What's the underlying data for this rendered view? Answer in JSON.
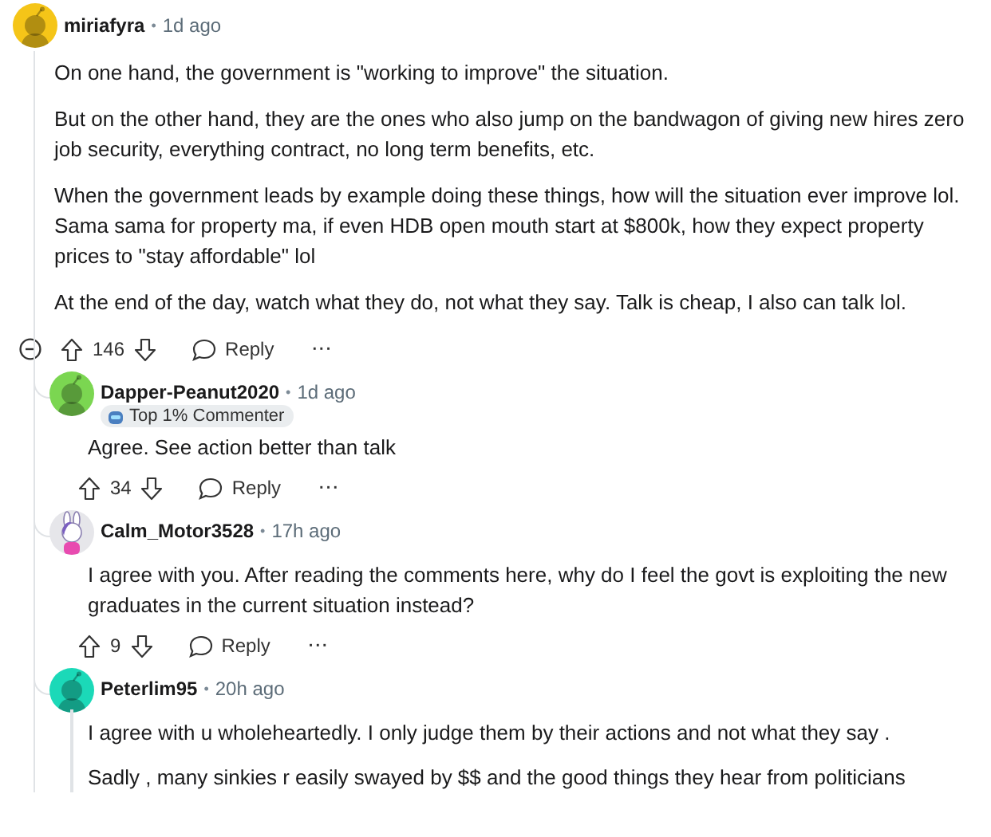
{
  "comment": {
    "author": "miriafyra",
    "separator": "•",
    "time": "1d ago",
    "avatar": {
      "kind": "default",
      "color": "#f5c518"
    },
    "paragraphs": [
      "On one hand, the government is \"working to improve\" the situation.",
      "But on the other hand, they are the ones who also jump on the bandwagon of giving new hires zero job security, everything contract, no long term benefits, etc.",
      "When the government leads by example doing these things, how will the situation ever improve lol. Sama sama for property ma, if even HDB open mouth start at $800k, how they expect property prices to \"stay affordable\" lol",
      "At the end of the day, watch what they do, not what they say. Talk is cheap, I also can talk lol."
    ],
    "expanded": true,
    "votes": "146",
    "reply_label": "Reply",
    "more": "···",
    "replies": [
      {
        "author": "Dapper-Peanut2020",
        "separator": "•",
        "time": "1d ago",
        "avatar": {
          "kind": "default",
          "color": "#7bd651"
        },
        "flair": "Top 1% Commenter",
        "paragraphs": [
          "Agree. See action better than talk"
        ],
        "votes": "34",
        "reply_label": "Reply",
        "more": "···"
      },
      {
        "author": "Calm_Motor3528",
        "separator": "•",
        "time": "17h ago",
        "avatar": {
          "kind": "custom",
          "color": "#e6e6ea"
        },
        "paragraphs": [
          "I agree with you. After reading the comments here, why do I feel the govt is exploiting the new graduates in the current situation instead?"
        ],
        "votes": "9",
        "reply_label": "Reply",
        "more": "···"
      },
      {
        "author": "Peterlim95",
        "separator": "•",
        "time": "20h ago",
        "avatar": {
          "kind": "default",
          "color": "#1bd9b8"
        },
        "has_replies": true,
        "paragraphs": [
          "I agree with u wholeheartedly. I only judge them by their actions and not what they say .",
          "Sadly , many sinkies r easily swayed by $$ and the good things they hear from politicians"
        ]
      }
    ]
  }
}
